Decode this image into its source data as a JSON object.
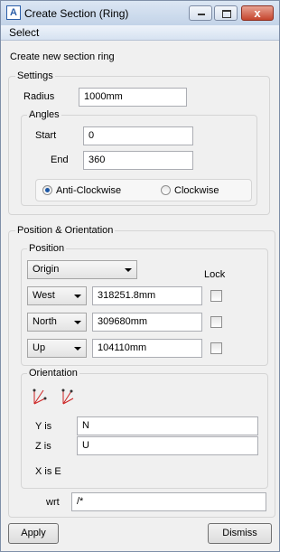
{
  "window": {
    "title": "Create Section (Ring)",
    "app_icon_glyph": "A",
    "close_glyph": "x"
  },
  "menu": {
    "select": "Select"
  },
  "header_text": "Create new section ring",
  "settings": {
    "legend": "Settings",
    "radius_label": "Radius",
    "radius_value": "1000mm",
    "angles": {
      "legend": "Angles",
      "start_label": "Start",
      "start_value": "0",
      "end_label": "End",
      "end_value": "360",
      "anticlockwise_label": "Anti-Clockwise",
      "clockwise_label": "Clockwise",
      "selected": "Anti-Clockwise"
    }
  },
  "position_orientation": {
    "legend": "Position & Orientation",
    "position": {
      "legend": "Position",
      "origin_select": "Origin",
      "lock_label": "Lock",
      "rows": [
        {
          "direction": "West",
          "value": "318251.8mm",
          "locked": false
        },
        {
          "direction": "North",
          "value": "309680mm",
          "locked": false
        },
        {
          "direction": "Up",
          "value": "104110mm",
          "locked": false
        }
      ]
    },
    "orientation": {
      "legend": "Orientation",
      "y_label": "Y is",
      "y_value": "N",
      "z_label": "Z is",
      "z_value": "U",
      "x_is": "X is E"
    },
    "wrt_label": "wrt",
    "wrt_value": "/*"
  },
  "buttons": {
    "apply": "Apply",
    "dismiss": "Dismiss"
  },
  "colors": {
    "axis_red": "#cc2222",
    "radio_selected": "#1c57a5",
    "close_button": "#c5452d"
  }
}
